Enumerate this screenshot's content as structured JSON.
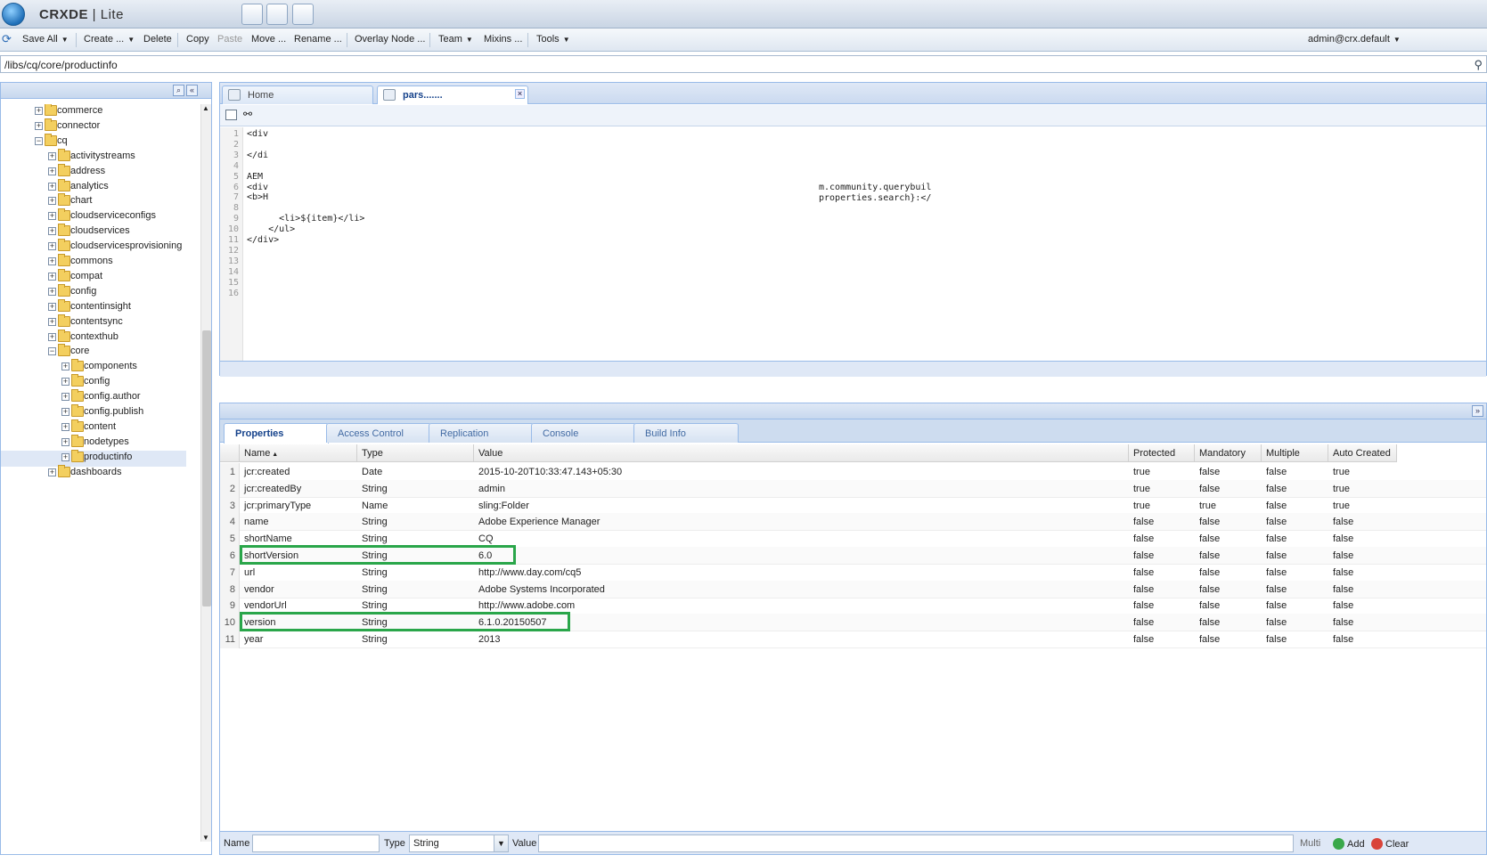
{
  "app": {
    "brand": "CRX",
    "brand_suffix": "DE",
    "edition": "Lite"
  },
  "toolbar": {
    "save_all": "Save All",
    "create": "Create ...",
    "delete": "Delete",
    "copy": "Copy",
    "paste": "Paste",
    "move": "Move ...",
    "rename": "Rename ...",
    "overlay_node": "Overlay Node ...",
    "team": "Team",
    "mixins": "Mixins ...",
    "tools": "Tools",
    "user": "admin@crx.default"
  },
  "address": {
    "path": "/libs/cq/core/productinfo"
  },
  "tree": {
    "nodes": [
      {
        "label": "commerce",
        "depth": 2,
        "expanded": false
      },
      {
        "label": "connector",
        "depth": 2,
        "expanded": false
      },
      {
        "label": "cq",
        "depth": 2,
        "expanded": true
      },
      {
        "label": "activitystreams",
        "depth": 3,
        "expanded": false
      },
      {
        "label": "address",
        "depth": 3,
        "expanded": false
      },
      {
        "label": "analytics",
        "depth": 3,
        "expanded": false
      },
      {
        "label": "chart",
        "depth": 3,
        "expanded": false
      },
      {
        "label": "cloudserviceconfigs",
        "depth": 3,
        "expanded": false
      },
      {
        "label": "cloudservices",
        "depth": 3,
        "expanded": false
      },
      {
        "label": "cloudservicesprovisioning",
        "depth": 3,
        "expanded": false
      },
      {
        "label": "commons",
        "depth": 3,
        "expanded": false
      },
      {
        "label": "compat",
        "depth": 3,
        "expanded": false
      },
      {
        "label": "config",
        "depth": 3,
        "expanded": false
      },
      {
        "label": "contentinsight",
        "depth": 3,
        "expanded": false
      },
      {
        "label": "contentsync",
        "depth": 3,
        "expanded": false
      },
      {
        "label": "contexthub",
        "depth": 3,
        "expanded": false
      },
      {
        "label": "core",
        "depth": 3,
        "expanded": true
      },
      {
        "label": "components",
        "depth": 4,
        "expanded": false
      },
      {
        "label": "config",
        "depth": 4,
        "expanded": false
      },
      {
        "label": "config.author",
        "depth": 4,
        "expanded": false
      },
      {
        "label": "config.publish",
        "depth": 4,
        "expanded": false
      },
      {
        "label": "content",
        "depth": 4,
        "expanded": false
      },
      {
        "label": "nodetypes",
        "depth": 4,
        "expanded": false
      },
      {
        "label": "productinfo",
        "depth": 4,
        "expanded": false,
        "selected": true
      },
      {
        "label": "dashboards",
        "depth": 3,
        "expanded": false
      }
    ]
  },
  "editor": {
    "tabs": [
      {
        "label": "Home"
      },
      {
        "label": "pars......."
      }
    ],
    "line_numbers": [
      "1",
      "2",
      "3",
      "4",
      "5",
      "6",
      "7",
      "8",
      "9",
      "10",
      "11",
      "12",
      "13",
      "14",
      "15",
      "16"
    ],
    "code": "<div\n\n</di\n\nAEM\n<div\n<b>H\n\n      <li>${item}</li>\n    </ul>\n</div>",
    "code_right": "m.community.querybuil\nproperties.search}:</"
  },
  "bottom": {
    "tabs": [
      "Properties",
      "Access Control",
      "Replication",
      "Console",
      "Build Info"
    ],
    "columns": [
      "Name",
      "Type",
      "Value",
      "Protected",
      "Mandatory",
      "Multiple",
      "Auto Created"
    ],
    "rows": [
      {
        "n": "1",
        "name": "jcr:created",
        "type": "Date",
        "value": "2015-10-20T10:33:47.143+05:30",
        "protected": "true",
        "mandatory": "false",
        "multiple": "false",
        "auto": "true"
      },
      {
        "n": "2",
        "name": "jcr:createdBy",
        "type": "String",
        "value": "admin",
        "protected": "true",
        "mandatory": "false",
        "multiple": "false",
        "auto": "true"
      },
      {
        "n": "3",
        "name": "jcr:primaryType",
        "type": "Name",
        "value": "sling:Folder",
        "protected": "true",
        "mandatory": "true",
        "multiple": "false",
        "auto": "true"
      },
      {
        "n": "4",
        "name": "name",
        "type": "String",
        "value": "Adobe Experience Manager",
        "protected": "false",
        "mandatory": "false",
        "multiple": "false",
        "auto": "false"
      },
      {
        "n": "5",
        "name": "shortName",
        "type": "String",
        "value": "CQ",
        "protected": "false",
        "mandatory": "false",
        "multiple": "false",
        "auto": "false"
      },
      {
        "n": "6",
        "name": "shortVersion",
        "type": "String",
        "value": "6.0",
        "protected": "false",
        "mandatory": "false",
        "multiple": "false",
        "auto": "false",
        "highlight": true
      },
      {
        "n": "7",
        "name": "url",
        "type": "String",
        "value": "http://www.day.com/cq5",
        "protected": "false",
        "mandatory": "false",
        "multiple": "false",
        "auto": "false"
      },
      {
        "n": "8",
        "name": "vendor",
        "type": "String",
        "value": "Adobe Systems Incorporated",
        "protected": "false",
        "mandatory": "false",
        "multiple": "false",
        "auto": "false"
      },
      {
        "n": "9",
        "name": "vendorUrl",
        "type": "String",
        "value": "http://www.adobe.com",
        "protected": "false",
        "mandatory": "false",
        "multiple": "false",
        "auto": "false"
      },
      {
        "n": "10",
        "name": "version",
        "type": "String",
        "value": "6.1.0.20150507",
        "protected": "false",
        "mandatory": "false",
        "multiple": "false",
        "auto": "false",
        "highlight": true
      },
      {
        "n": "11",
        "name": "year",
        "type": "String",
        "value": "2013",
        "protected": "false",
        "mandatory": "false",
        "multiple": "false",
        "auto": "false"
      }
    ],
    "form": {
      "name_label": "Name",
      "type_label": "Type",
      "type_value": "String",
      "value_label": "Value",
      "multi_label": "Multi",
      "add_label": "Add",
      "clear_label": "Clear"
    }
  },
  "colors": {
    "highlight": "#2aa64a",
    "panel_border": "#99bbe8"
  }
}
